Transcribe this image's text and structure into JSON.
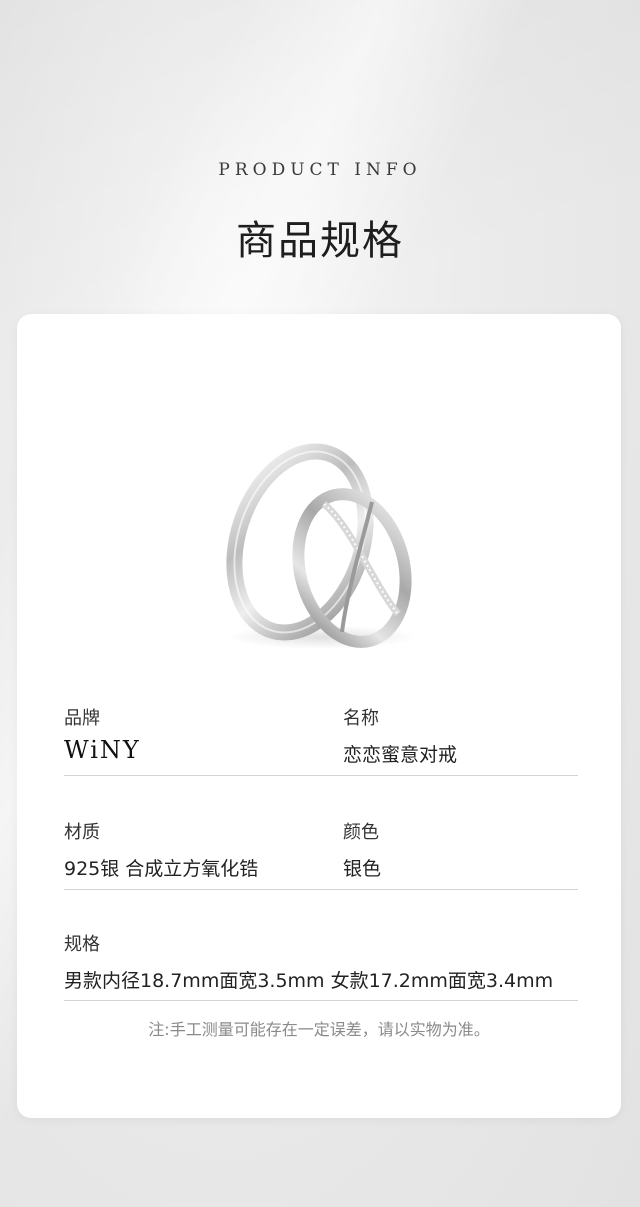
{
  "header": {
    "title_en": "PRODUCT INFO",
    "title_cn": "商品规格"
  },
  "specs": {
    "brand": {
      "label": "品牌",
      "value": "WiNY"
    },
    "name": {
      "label": "名称",
      "value": "恋恋蜜意对戒"
    },
    "material": {
      "label": "材质",
      "value": "925银 合成立方氧化锆"
    },
    "color": {
      "label": "颜色",
      "value": "银色"
    },
    "size": {
      "label": "规格",
      "value": "男款内径18.7mm面宽3.5mm 女款17.2mm面宽3.4mm"
    }
  },
  "note": "注:手工测量可能存在一定误差，请以实物为准。",
  "image": {
    "icon": "ring-pair-image"
  },
  "colors": {
    "background": "#e8e8e8",
    "card": "#ffffff",
    "divider": "#d3d3d3",
    "note": "#8a8a8a"
  }
}
